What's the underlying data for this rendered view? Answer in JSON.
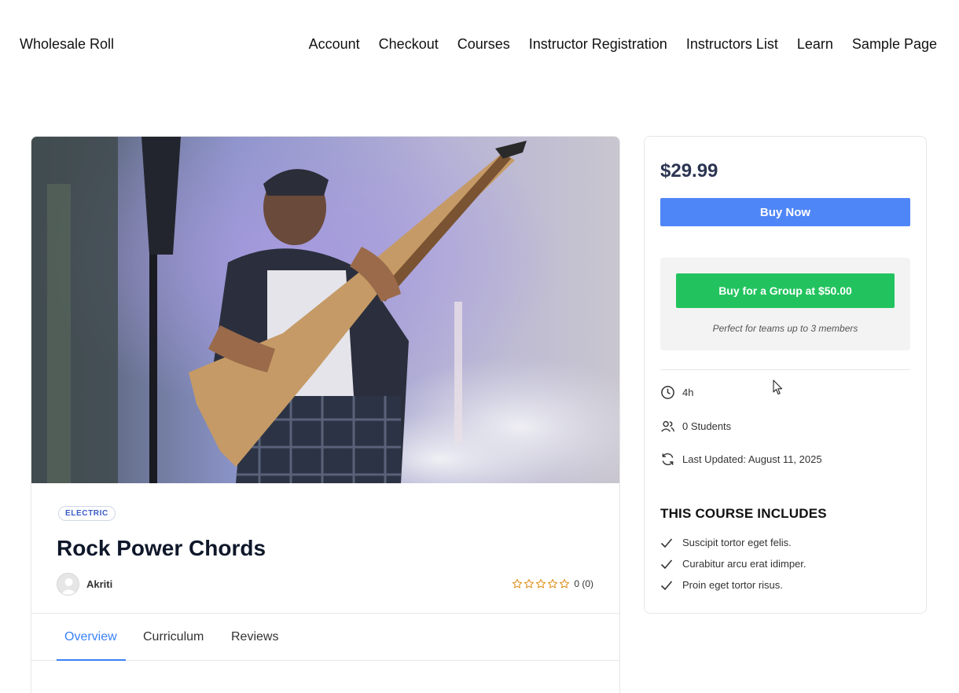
{
  "header": {
    "site_title": "Wholesale Roll",
    "nav": [
      "Account",
      "Checkout",
      "Courses",
      "Instructor Registration",
      "Instructors List",
      "Learn",
      "Sample Page"
    ]
  },
  "course": {
    "category_tag": "ELECTRIC",
    "title": "Rock Power Chords",
    "author": "Akriti",
    "rating_text": "0 (0)",
    "rating_value": 0,
    "rating_max": 5,
    "tabs": [
      "Overview",
      "Curriculum",
      "Reviews"
    ],
    "active_tab": "Overview"
  },
  "sidebar": {
    "price": "$29.99",
    "buy_now_label": "Buy Now",
    "group_button_label": "Buy for a Group at $50.00",
    "group_note": "Perfect for teams up to 3 members",
    "duration": "4h",
    "students": "0 Students",
    "last_updated": "Last Updated: August 11, 2025",
    "includes_title": "THIS COURSE INCLUDES",
    "includes": [
      "Suscipit tortor eget felis.",
      "Curabitur arcu erat idimper.",
      "Proin eget tortor risus."
    ]
  },
  "colors": {
    "accent_blue": "#4f86f7",
    "active_tab": "#3b82f6",
    "group_green": "#22c35e",
    "star_orange": "#e0901c"
  },
  "icons": {
    "duration": "clock-icon",
    "students": "users-icon",
    "updated": "refresh-icon",
    "include_item": "check-icon",
    "rating": "star-outline-icon"
  }
}
